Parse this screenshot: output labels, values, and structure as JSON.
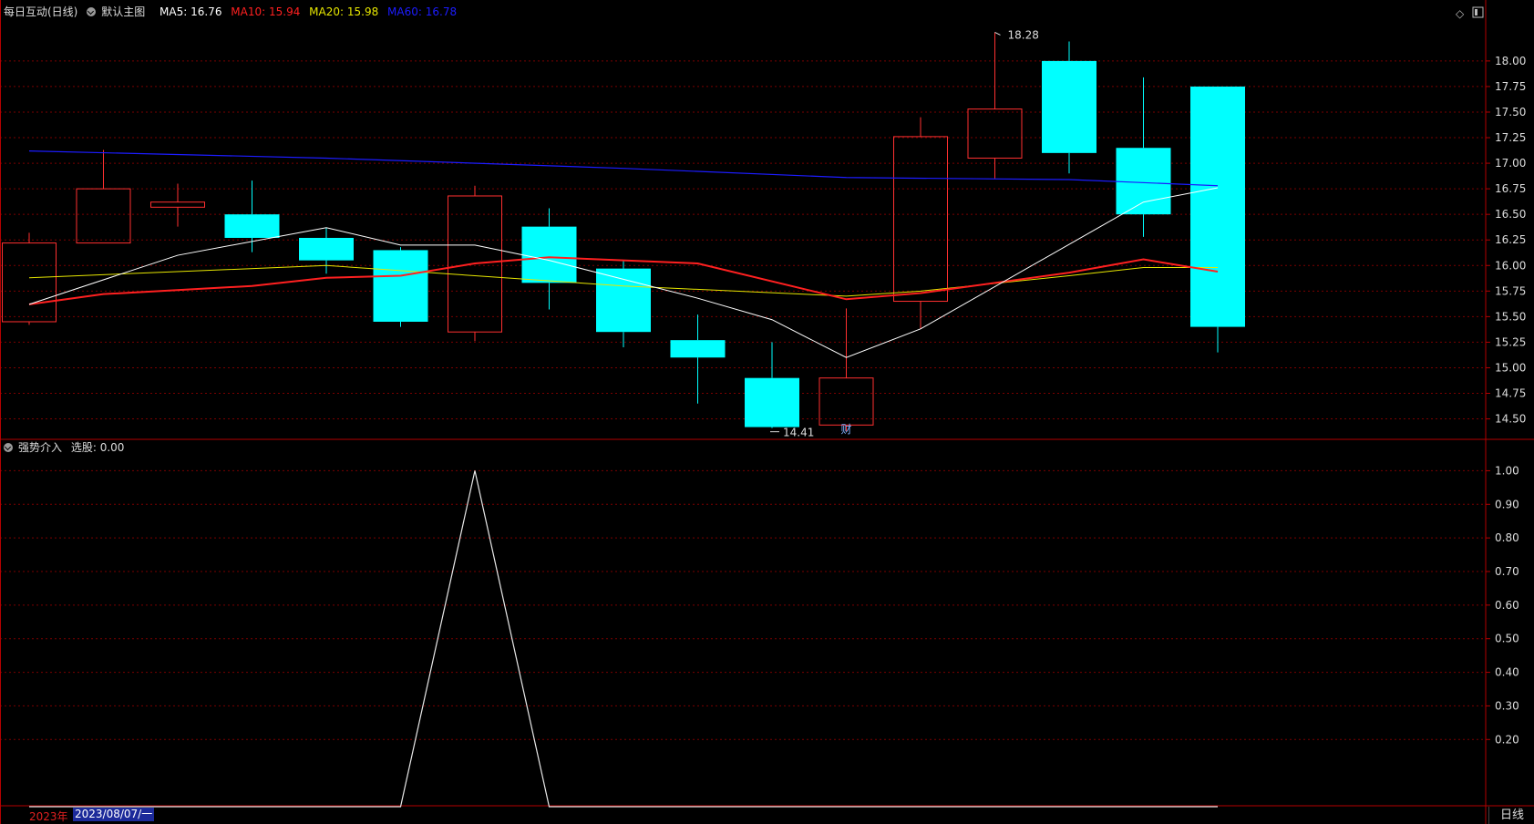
{
  "header": {
    "stock_label": "每日互动(日线)",
    "template_label": "默认主图",
    "ma5": {
      "label": "MA5: 16.76",
      "color": "#ffffff"
    },
    "ma10": {
      "label": "MA10: 15.94",
      "color": "#ff2020"
    },
    "ma20": {
      "label": "MA20: 15.98",
      "color": "#e6e600"
    },
    "ma60": {
      "label": "MA60: 16.78",
      "color": "#1c1cff"
    }
  },
  "sub_header": {
    "indicator_label": "强势介入",
    "value_label": "选股: 0.00"
  },
  "footer": {
    "year_label": "2023年",
    "current_date": "2023/08/07/一",
    "period_button": "日线"
  },
  "colors": {
    "up": "#ff3030",
    "down": "#00ffff",
    "axis": "#b40000",
    "grid": "#7a0000",
    "background": "#000000"
  },
  "chart_data": [
    {
      "type": "candlestick",
      "ylim": [
        14.3,
        18.4
      ],
      "yticks": [
        "18.00",
        "17.75",
        "17.50",
        "17.25",
        "17.00",
        "16.75",
        "16.50",
        "16.25",
        "16.00",
        "15.75",
        "15.50",
        "15.25",
        "15.00",
        "14.75",
        "14.50"
      ],
      "candles": [
        {
          "open": 15.45,
          "close": 16.22,
          "high": 16.32,
          "low": 15.42
        },
        {
          "open": 16.22,
          "close": 16.75,
          "high": 17.13,
          "low": 16.22
        },
        {
          "open": 16.57,
          "close": 16.62,
          "high": 16.8,
          "low": 16.38
        },
        {
          "open": 16.5,
          "close": 16.27,
          "high": 16.83,
          "low": 16.13
        },
        {
          "open": 16.27,
          "close": 16.05,
          "high": 16.37,
          "low": 15.92
        },
        {
          "open": 16.15,
          "close": 15.45,
          "high": 16.18,
          "low": 15.4
        },
        {
          "open": 15.35,
          "close": 16.68,
          "high": 16.78,
          "low": 15.26
        },
        {
          "open": 16.38,
          "close": 15.83,
          "high": 16.56,
          "low": 15.57
        },
        {
          "open": 15.97,
          "close": 15.35,
          "high": 16.05,
          "low": 15.2
        },
        {
          "open": 15.27,
          "close": 15.1,
          "high": 15.52,
          "low": 14.65
        },
        {
          "open": 14.9,
          "close": 14.42,
          "high": 15.25,
          "low": 14.41
        },
        {
          "open": 14.44,
          "close": 14.9,
          "high": 15.58,
          "low": 14.38
        },
        {
          "open": 15.65,
          "close": 17.26,
          "high": 17.45,
          "low": 15.38
        },
        {
          "open": 17.05,
          "close": 17.53,
          "high": 18.28,
          "low": 16.85
        },
        {
          "open": 18.0,
          "close": 17.1,
          "high": 18.19,
          "low": 16.9
        },
        {
          "open": 17.15,
          "close": 16.5,
          "high": 17.84,
          "low": 16.28
        },
        {
          "open": 17.75,
          "close": 15.4,
          "high": 17.75,
          "low": 15.15
        }
      ],
      "ma5_points": [
        [
          0,
          15.62
        ],
        [
          2,
          16.1
        ],
        [
          4,
          16.37
        ],
        [
          5,
          16.2
        ],
        [
          6,
          16.2
        ],
        [
          7,
          16.05
        ],
        [
          9,
          15.68
        ],
        [
          10,
          15.47
        ],
        [
          11,
          15.1
        ],
        [
          12,
          15.38
        ],
        [
          15,
          16.62
        ],
        [
          16,
          16.76
        ]
      ],
      "ma10_points": [
        [
          0,
          15.62
        ],
        [
          1,
          15.72
        ],
        [
          3,
          15.8
        ],
        [
          4,
          15.88
        ],
        [
          5,
          15.9
        ],
        [
          6,
          16.02
        ],
        [
          7,
          16.08
        ],
        [
          9,
          16.02
        ],
        [
          11,
          15.67
        ],
        [
          12,
          15.73
        ],
        [
          14,
          15.93
        ],
        [
          15,
          16.06
        ],
        [
          16,
          15.94
        ]
      ],
      "ma20_points": [
        [
          0,
          15.88
        ],
        [
          4,
          16.0
        ],
        [
          6,
          15.9
        ],
        [
          8,
          15.8
        ],
        [
          11,
          15.7
        ],
        [
          12,
          15.75
        ],
        [
          14,
          15.9
        ],
        [
          15,
          15.98
        ],
        [
          16,
          15.98
        ]
      ],
      "ma60_points": [
        [
          0,
          17.12
        ],
        [
          4,
          17.05
        ],
        [
          8,
          16.95
        ],
        [
          11,
          16.86
        ],
        [
          14,
          16.84
        ],
        [
          16,
          16.78
        ]
      ],
      "annotations": [
        {
          "label": "18.28",
          "candle": 13,
          "value": 18.28,
          "side": "top"
        },
        {
          "label": "14.41",
          "candle": 10,
          "value": 14.41,
          "side": "bottom"
        },
        {
          "label": "财",
          "candle": 11,
          "value": 14.3,
          "side": "marker"
        }
      ]
    },
    {
      "type": "line",
      "name": "选股",
      "ylim": [
        0.0,
        1.05
      ],
      "yticks": [
        "1.00",
        "0.90",
        "0.80",
        "0.70",
        "0.60",
        "0.50",
        "0.40",
        "0.30",
        "0.20"
      ],
      "values": [
        0,
        0,
        0,
        0,
        0,
        0,
        1,
        0,
        0,
        0,
        0,
        0,
        0,
        0,
        0,
        0,
        0
      ]
    }
  ]
}
